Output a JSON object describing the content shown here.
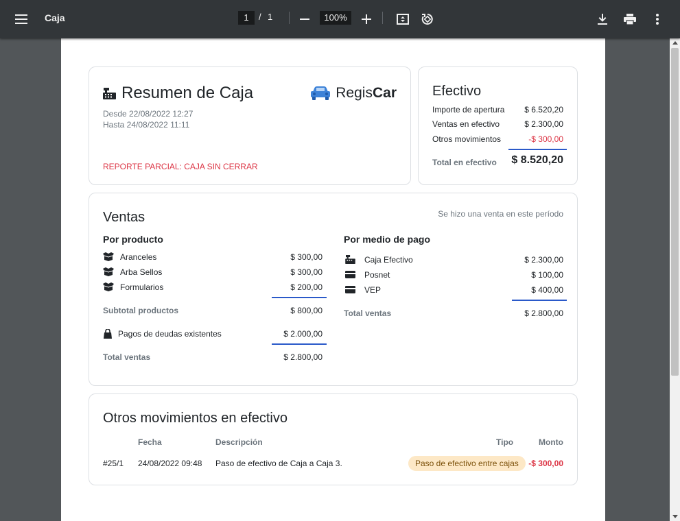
{
  "toolbar": {
    "title": "Caja",
    "current_page": "1",
    "page_separator": "/",
    "total_pages": "1",
    "zoom": "100%"
  },
  "resumen": {
    "title": "Resumen de Caja",
    "desde": "Desde 22/08/2022 12:27",
    "hasta": "Hasta 24/08/2022 11:11",
    "warning": "REPORTE PARCIAL: CAJA SIN CERRAR",
    "brand_regular": "Regis",
    "brand_bold": "Car"
  },
  "efectivo": {
    "title": "Efectivo",
    "rows": [
      {
        "label": "Importe de apertura",
        "value": "$ 6.520,20"
      },
      {
        "label": "Ventas en efectivo",
        "value": "$ 2.300,00"
      },
      {
        "label": "Otros movimientos",
        "value": "-$ 300,00"
      }
    ],
    "total_label": "Total en efectivo",
    "total_value": "$ 8.520,20"
  },
  "ventas": {
    "title": "Ventas",
    "note": "Se hizo una venta en este período",
    "por_producto": {
      "title": "Por producto",
      "items": [
        {
          "label": "Aranceles",
          "value": "$ 300,00"
        },
        {
          "label": "Arba Sellos",
          "value": "$ 300,00"
        },
        {
          "label": "Formularios",
          "value": "$ 200,00"
        }
      ],
      "subtotal_label": "Subtotal productos",
      "subtotal_value": "$ 800,00",
      "deudas_label": "Pagos de deudas existentes",
      "deudas_value": "$ 2.000,00",
      "total_label": "Total ventas",
      "total_value": "$ 2.800,00"
    },
    "por_medio": {
      "title": "Por medio de pago",
      "items": [
        {
          "label": "Caja Efectivo",
          "value": "$ 2.300,00",
          "icon": "cash-register-icon"
        },
        {
          "label": "Posnet",
          "value": "$ 100,00",
          "icon": "credit-card-icon"
        },
        {
          "label": "VEP",
          "value": "$ 400,00",
          "icon": "credit-card-icon"
        }
      ],
      "total_label": "Total ventas",
      "total_value": "$ 2.800,00"
    }
  },
  "otros": {
    "title": "Otros movimientos en efectivo",
    "columns": {
      "fecha": "Fecha",
      "descripcion": "Descripción",
      "tipo": "Tipo",
      "monto": "Monto"
    },
    "rows": [
      {
        "id": "#25/1",
        "fecha": "24/08/2022 09:48",
        "descripcion": "Paso de efectivo de Caja a Caja 3.",
        "tipo": "Paso de efectivo entre cajas",
        "monto": "-$ 300,00"
      }
    ]
  },
  "colors": {
    "toolbar": "#323639",
    "viewer_bg": "#525659",
    "accent_line": "#2a59c9",
    "negative": "#dc3545",
    "badge_bg": "#fde8c6"
  }
}
